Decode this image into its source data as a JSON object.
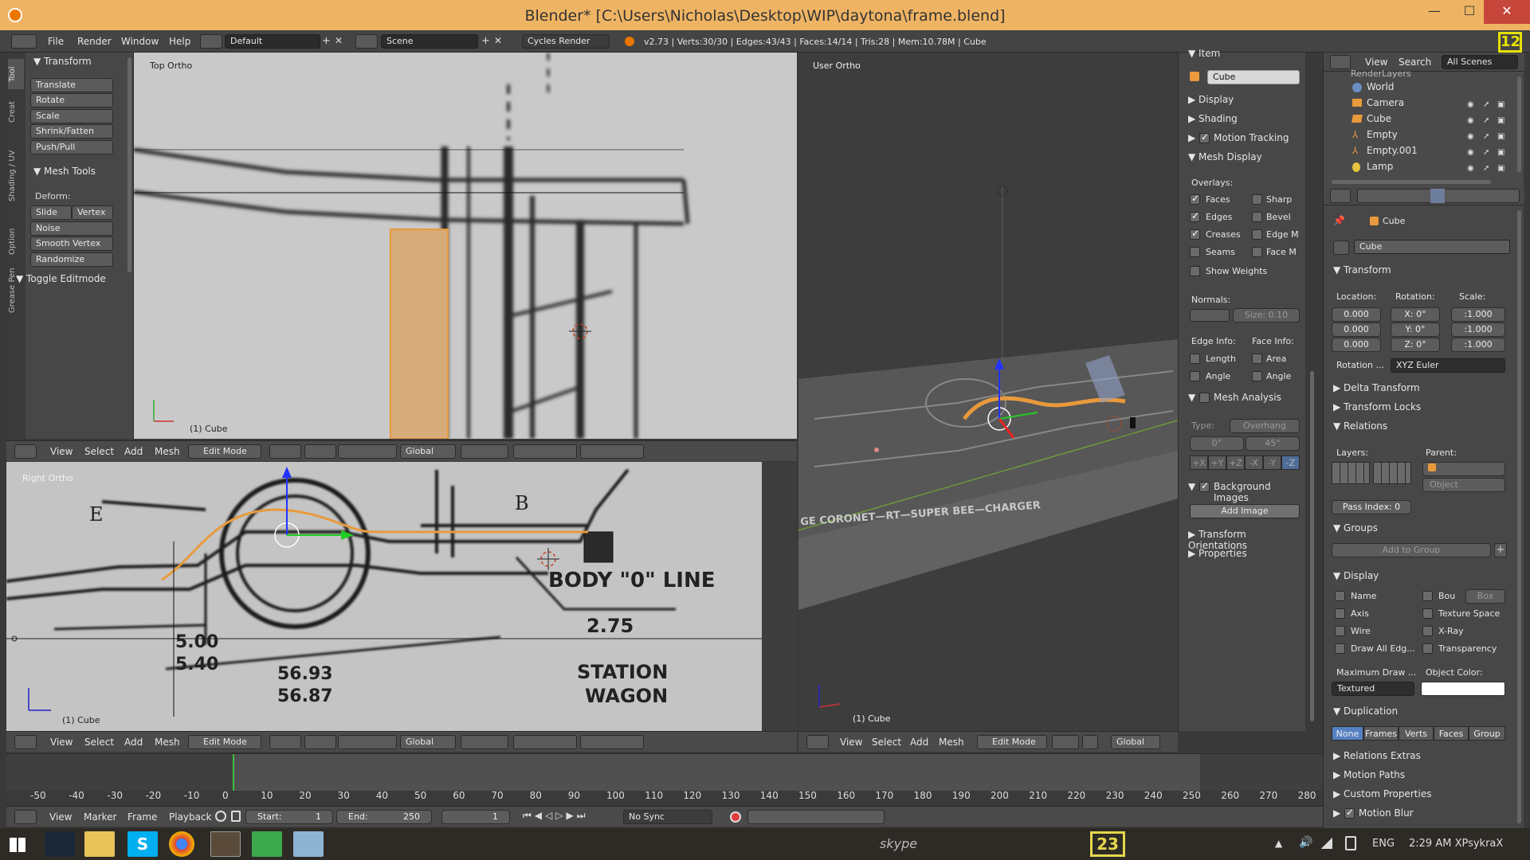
{
  "window": {
    "title": "Blender* [C:\\Users\\Nicholas\\Desktop\\WIP\\daytona\\frame.blend]",
    "minimize": "—",
    "maximize": "☐",
    "close": "✕"
  },
  "infobar": {
    "menus": [
      "File",
      "Render",
      "Window",
      "Help"
    ],
    "layout": "Default",
    "scene": "Scene",
    "engine": "Cycles Render",
    "stats": "v2.73 | Verts:30/30 | Edges:43/43 | Faces:14/14 | Tris:28 | Mem:10.78M | Cube"
  },
  "tool_shelf": {
    "tabs": [
      "Tool",
      "Creat",
      "Shading / UV",
      "Option",
      "Grease Pen"
    ],
    "transform_header": "Transform",
    "transform_buttons": [
      "Translate",
      "Rotate",
      "Scale",
      "Shrink/Fatten",
      "Push/Pull"
    ],
    "mesh_tools_header": "Mesh Tools",
    "deform_label": "Deform:",
    "slide_edge": "Slide Ed",
    "vertex": "Vertex",
    "mesh_buttons": [
      "Noise",
      "Smooth Vertex",
      "Randomize"
    ],
    "toggle_editmode": "Toggle Editmode"
  },
  "viewport_top": {
    "label": "Top Ortho",
    "object_label": "(1) Cube"
  },
  "viewport_right": {
    "label": "Right Ortho",
    "object_label": "(1) Cube",
    "blueprint_text": {
      "body_line": "BODY \"0\" LINE",
      "dim1": "2.75",
      "dim2": "5.00",
      "dim3": "5.40",
      "dim4": "56.93",
      "dim5": "56.87",
      "station": "STATION",
      "wagon": "WAGON",
      "letter_e": "E",
      "letter_b": "B"
    }
  },
  "viewport_user": {
    "label": "User Ortho",
    "object_label": "(1) Cube",
    "ground_text": "GE CORONET—RT—SUPER BEE—CHARGER"
  },
  "viewport_header": {
    "menus": [
      "View",
      "Select",
      "Add",
      "Mesh"
    ],
    "mode": "Edit Mode",
    "orientation": "Global"
  },
  "properties_region": {
    "item_header": "Item",
    "object_name": "Cube",
    "display": "Display",
    "shading": "Shading",
    "motion_tracking": "Motion Tracking",
    "mesh_display": "Mesh Display",
    "overlays_label": "Overlays:",
    "overlays_left": [
      {
        "label": "Faces",
        "checked": true
      },
      {
        "label": "Edges",
        "checked": true
      },
      {
        "label": "Creases",
        "checked": true
      },
      {
        "label": "Seams",
        "checked": false
      }
    ],
    "overlays_right": [
      {
        "label": "Sharp",
        "checked": false
      },
      {
        "label": "Bevel",
        "checked": false
      },
      {
        "label": "Edge M",
        "checked": false
      },
      {
        "label": "Face M",
        "checked": false
      }
    ],
    "show_weights": "Show Weights",
    "normals_label": "Normals:",
    "normals_size": "Size:  0.10",
    "edge_info": "Edge Info:",
    "face_info": "Face Info:",
    "edge_length": "Length",
    "edge_angle": "Angle",
    "face_area": "Area",
    "face_angle": "Angle",
    "mesh_analysis": "Mesh Analysis",
    "type_label": "Type:",
    "type_value": "Overhang",
    "angle_min": "0°",
    "angle_max": "45°",
    "axes": [
      "+X",
      "+Y",
      "+Z",
      "-X",
      "-Y",
      "-Z"
    ],
    "background_images": "Background Images",
    "add_image": "Add Image",
    "transform_orientations": "Transform Orientations",
    "properties": "Properties"
  },
  "outliner": {
    "menus": [
      "View",
      "Search"
    ],
    "filter": "All Scenes",
    "items": [
      "RenderLayers",
      "World",
      "Camera",
      "Cube",
      "Empty",
      "Empty.001",
      "Lamp"
    ]
  },
  "properties_editor": {
    "object_name": "Cube",
    "breadcrumb": "Cube",
    "transform": "Transform",
    "location_label": "Location:",
    "rotation_label": "Rotation:",
    "scale_label": "Scale:",
    "location": [
      "0.000",
      "0.000",
      "0.000"
    ],
    "rotation": [
      "X:    0°",
      "Y:    0°",
      "Z:    0°"
    ],
    "scale": [
      ":1.000",
      ":1.000",
      ":1.000"
    ],
    "rotation_mode_label": "Rotation ...",
    "rotation_mode": "XYZ Euler",
    "delta_transform": "Delta Transform",
    "transform_locks": "Transform Locks",
    "relations": "Relations",
    "layers_label": "Layers:",
    "parent_label": "Parent:",
    "parent_type": "Object",
    "pass_index": "Pass Index:    0",
    "groups": "Groups",
    "add_to_group": "Add to Group",
    "display": "Display",
    "display_left": [
      "Name",
      "Axis",
      "Wire",
      "Draw All Edg..."
    ],
    "display_right": [
      "Bou",
      "Texture Space",
      "X-Ray",
      "Transparency"
    ],
    "bounds_type": "Box",
    "max_draw_label": "Maximum Draw ...",
    "object_color_label": "Object Color:",
    "max_draw_value": "Textured",
    "duplication": "Duplication",
    "dup_tabs": [
      "None",
      "Frames",
      "Verts",
      "Faces",
      "Group"
    ],
    "relations_extras": "Relations Extras",
    "motion_paths": "Motion Paths",
    "custom_properties": "Custom Properties",
    "motion_blur": "Motion Blur"
  },
  "timeline": {
    "ticks": [
      "-50",
      "-40",
      "-30",
      "-20",
      "-10",
      "0",
      "10",
      "20",
      "30",
      "40",
      "50",
      "60",
      "70",
      "80",
      "90",
      "100",
      "110",
      "120",
      "130",
      "140",
      "150",
      "160",
      "170",
      "180",
      "190",
      "200",
      "210",
      "220",
      "230",
      "240",
      "250",
      "260",
      "270",
      "280"
    ],
    "menus": [
      "View",
      "Marker",
      "Frame",
      "Playback"
    ],
    "start": "Start:",
    "start_value": "1",
    "end": "End:",
    "end_value": "250",
    "current": "1",
    "sync": "No Sync"
  },
  "taskbar": {
    "language": "ENG",
    "clock": "2:29 AM XPsykraX",
    "skype": "skype"
  },
  "colors": {
    "title_bar": "#efb463",
    "selection_orange": "#e89a3c",
    "viewport_bg": "#3d3d3d",
    "panel_bg": "#464646"
  }
}
